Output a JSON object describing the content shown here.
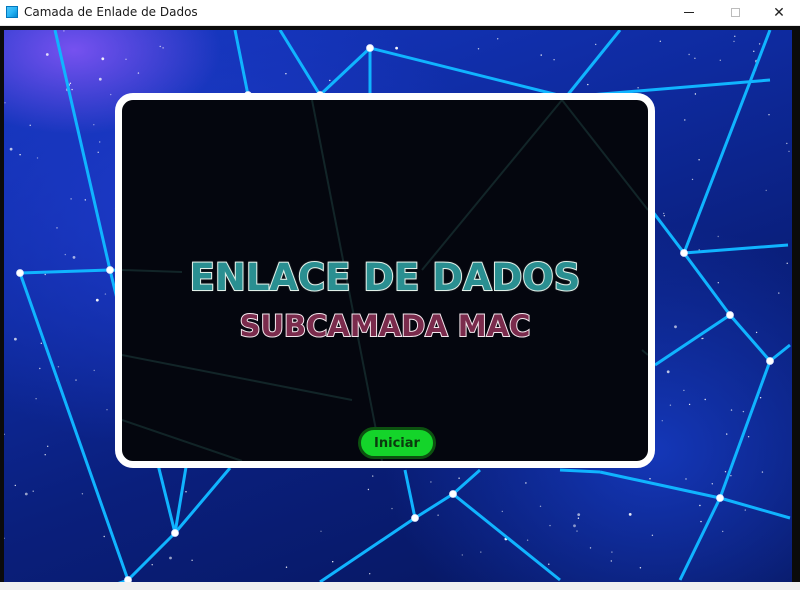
{
  "window": {
    "title": "Camada de Enlade de Dados",
    "controls": {
      "minimize_icon": "minimize-icon",
      "maximize_icon": "maximize-icon",
      "close_icon": "close-icon",
      "close_glyph": "✕"
    }
  },
  "scene": {
    "background": "starfield-network",
    "line_color": "#10b4ff",
    "node_color": "#ffffff"
  },
  "panel": {
    "title": "ENLACE DE DADOS",
    "subtitle": "SUBCAMADA MAC",
    "title_color": "#2a8f91",
    "subtitle_color": "#7a2b4c",
    "start_button_label": "Iniciar",
    "start_button_color": "#14d42a"
  }
}
